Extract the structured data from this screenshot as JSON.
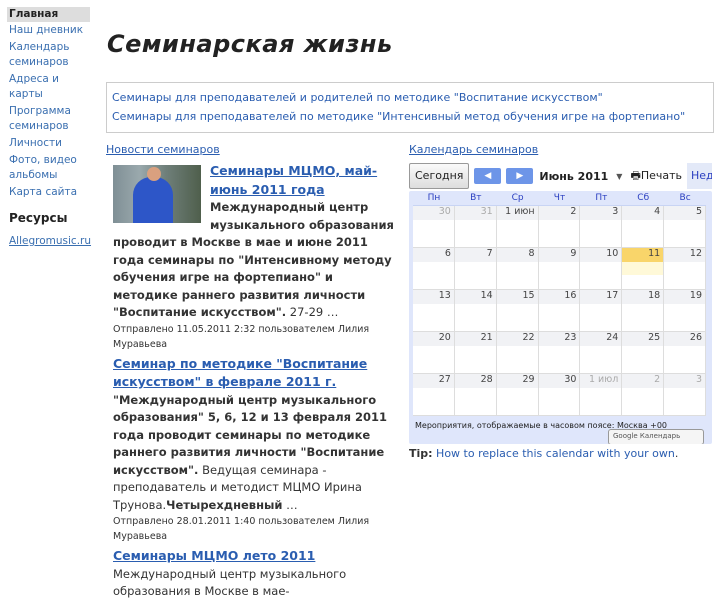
{
  "sidebar": {
    "home": "Главная",
    "items": [
      "Наш дневник",
      "Календарь семинаров",
      "Адреса и карты",
      "Программа семинаров",
      "Личности",
      "Фото, видео альбомы",
      "Карта сайта"
    ],
    "resources_heading": "Ресурсы",
    "resource_link": "Allegromusic.ru"
  },
  "page_title": "Семинарская жизнь",
  "seminar_links": [
    "Семинары для преподавателей и родителей по методике \"Воспитание искусством\"",
    "Семинары для преподавателей по методике \"Интенсивный метод обучения игре на фортепиано\""
  ],
  "news": {
    "heading": "Новости семинаров",
    "items": [
      {
        "title": "Семинары МЦМО, май-июнь 2011 года",
        "body_bold": "Международный центр музыкального образования проводит в Москве в мае и июне 2011 года семинары по \"Интенсивному методу обучения игре на фортепиано\" и методике раннего развития личности \"Воспитание искусством\".",
        "body": " 27-29 …",
        "meta": "Отправлено 11.05.2011 2:32 пользователем Лилия Муравьева"
      },
      {
        "title": "Семинар по методике \"Воспитание искусством\" в феврале 2011 г.",
        "body_bold": "\"Международный центр музыкального образования\" 5, 6, 12 и 13 февраля 2011 года проводит семинары по методике раннего развития личности \"Воспитание искусством\".",
        "body": " Ведущая семинара - преподаватель и методист МЦМО Ирина Трунова.",
        "body_bold2": "Четырехдневный",
        "body2": " …",
        "meta": "Отправлено 28.01.2011 1:40 пользователем Лилия Муравьева"
      },
      {
        "title": "Семинары МЦМО лето 2011",
        "body": " Международный центр музыкального образования в Москве в мае-"
      }
    ]
  },
  "calendar": {
    "heading": "Календарь семинаров",
    "today": "Сегодня",
    "month": "Июнь 2011",
    "print": "Печать",
    "view": "Неделя",
    "weekdays": [
      "Пн",
      "Вт",
      "Ср",
      "Чт",
      "Пт",
      "Сб",
      "Вс"
    ],
    "weeks": [
      [
        "30",
        "31",
        "1 июн",
        "2",
        "3",
        "4",
        "5"
      ],
      [
        "6",
        "7",
        "8",
        "9",
        "10",
        "11",
        "12"
      ],
      [
        "13",
        "14",
        "15",
        "16",
        "17",
        "18",
        "19"
      ],
      [
        "20",
        "21",
        "22",
        "23",
        "24",
        "25",
        "26"
      ],
      [
        "27",
        "28",
        "29",
        "30",
        "1 июл",
        "2",
        "3"
      ]
    ],
    "today_date": "11",
    "timezone_note": "Мероприятия, отображаемые в часовом поясе: Москва +00",
    "google_badge": "Google Календарь",
    "tip_label": "Tip:",
    "tip_link": "How to replace this calendar with your own",
    "tip_end": "."
  }
}
